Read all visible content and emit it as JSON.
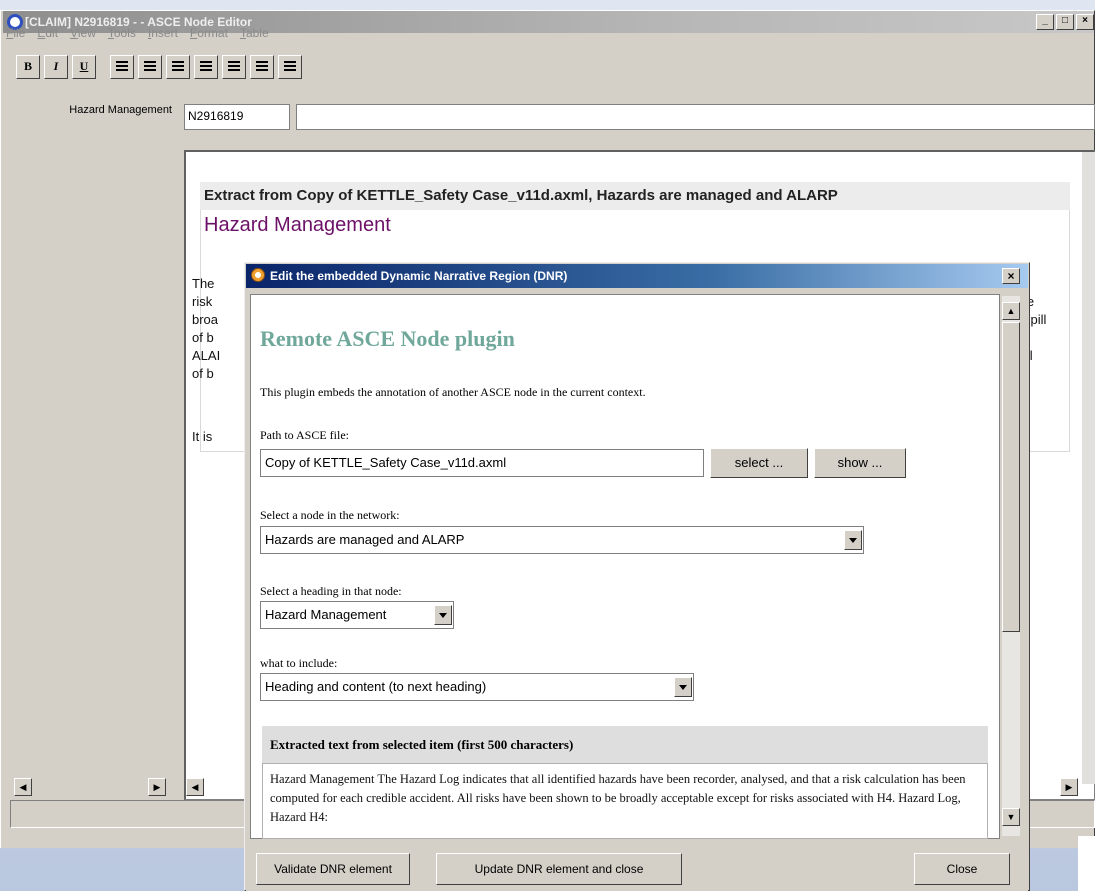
{
  "window": {
    "title": "[CLAIM] N2916819 -  - ASCE Node Editor",
    "controls": [
      "_",
      "□",
      "×"
    ]
  },
  "menu": [
    "File",
    "Edit",
    "View",
    "Tools",
    "Insert",
    "Format",
    "Table"
  ],
  "toolbar": {
    "bold": "B",
    "italic": "I",
    "underline": "U"
  },
  "nav": {
    "label": "Hazard Management"
  },
  "node": {
    "id": "N2916819",
    "title": ""
  },
  "document": {
    "extract_header": "Extract from Copy of KETTLE_Safety Case_v11d.axml, Hazards are managed and ALARP",
    "heading": "Hazard Management",
    "left_fragments": "The\nrisk\nbroa\nof b\nALAI\nof b",
    "right_fragments": "ie\nspill\n\nill",
    "trailing": "It is"
  },
  "dialog": {
    "title": "Edit the embedded Dynamic Narrative Region (DNR)",
    "close": "×",
    "plugin_title": "Remote ASCE Node plugin",
    "description": "This plugin embeds the annotation of another ASCE node in the current context.",
    "path_label": "Path to ASCE file:",
    "path_value": "Copy of KETTLE_Safety Case_v11d.axml",
    "select_button": "select ...",
    "show_button": "show ...",
    "node_label": "Select a node in the network:",
    "node_value": "Hazards are managed and ALARP",
    "heading_label": "Select a heading in that node:",
    "heading_value": "Hazard Management",
    "include_label": "what to include:",
    "include_value": "Heading and content (to next heading)",
    "extracted_header": "Extracted text from selected item (first 500 characters)",
    "extracted_text": "Hazard Management The Hazard Log indicates that all identified hazards have been recorder, analysed, and that a risk calculation has been computed for each credible accident. All risks have been shown to be broadly acceptable except for risks associated with H4. Hazard Log, Hazard H4:",
    "validate_button": "Validate DNR element",
    "update_button": "Update DNR element and close",
    "close_button": "Close"
  }
}
